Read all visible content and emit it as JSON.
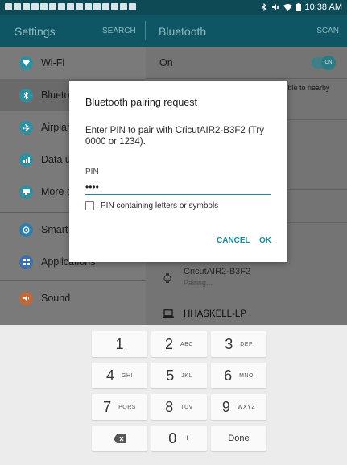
{
  "status_bar": {
    "time": "10:38 AM"
  },
  "toolbar": {
    "left_title": "Settings",
    "search": "SEARCH",
    "right_title": "Bluetooth",
    "scan": "SCAN"
  },
  "sidebar": {
    "items": [
      {
        "label": "Wi-Fi",
        "icon": "wifi-icon",
        "color": "#2f8fa0"
      },
      {
        "label": "Bluetoo",
        "icon": "bluetooth-icon",
        "color": "#2f8fa0"
      },
      {
        "label": "Airplan",
        "icon": "airplane-icon",
        "color": "#2f8fa0"
      },
      {
        "label": "Data us",
        "icon": "data-usage-icon",
        "color": "#2f8fa0"
      },
      {
        "label": "More c",
        "icon": "more-connections-icon",
        "color": "#2f8fa0"
      },
      {
        "label": "Smart I",
        "icon": "smart-manager-icon",
        "color": "#2f7ea8"
      },
      {
        "label": "Applications",
        "icon": "applications-icon",
        "color": "#3b6fb0"
      },
      {
        "label": "Sound",
        "icon": "sound-icon",
        "color": "#c0683a"
      }
    ]
  },
  "bluetooth": {
    "on_label": "On",
    "toggle_text": "ON",
    "visible_text": "isible to nearby",
    "devices": [
      {
        "name": "CricutAIR2-B3F2",
        "status": "Pairing...",
        "icon": "watch-icon"
      },
      {
        "name": "HHASKELL-LP",
        "icon": "laptop-icon"
      }
    ]
  },
  "dialog": {
    "title": "Bluetooth pairing request",
    "message": "Enter PIN to pair with CricutAIR2-B3F2 (Try 0000 or 1234).",
    "pin_label": "PIN",
    "pin_value": "••••",
    "checkbox_label": "PIN containing letters or symbols",
    "cancel": "CANCEL",
    "ok": "OK"
  },
  "keyboard": {
    "keys": [
      {
        "digit": "1",
        "letters": ""
      },
      {
        "digit": "2",
        "letters": "ABC"
      },
      {
        "digit": "3",
        "letters": "DEF"
      },
      {
        "digit": "4",
        "letters": "GHI"
      },
      {
        "digit": "5",
        "letters": "JKL"
      },
      {
        "digit": "6",
        "letters": "MNO"
      },
      {
        "digit": "7",
        "letters": "PQRS"
      },
      {
        "digit": "8",
        "letters": "TUV"
      },
      {
        "digit": "9",
        "letters": "WXYZ"
      }
    ],
    "zero": "0",
    "plus": "+",
    "done": "Done",
    "backspace_icon": "backspace-icon"
  },
  "colors": {
    "accent": "#1a8a97",
    "toolbar": "#0e5663",
    "statusbar": "#0d4a55"
  }
}
